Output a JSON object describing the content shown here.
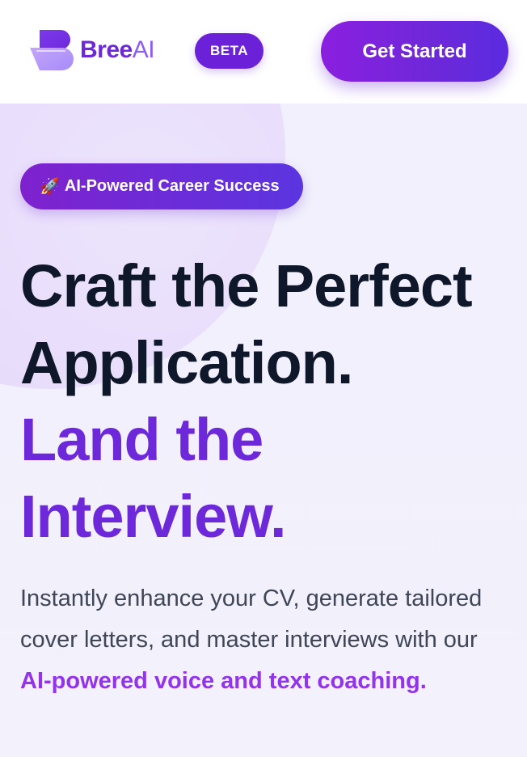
{
  "header": {
    "logo_name": "Bree",
    "logo_suffix": "AI",
    "beta_label": "BETA",
    "cta_label": "Get Started"
  },
  "hero": {
    "tagline_icon": "🚀",
    "tagline": "AI-Powered Career Success",
    "headline_line1": "Craft the Perfect",
    "headline_line2": "Application.",
    "headline_accent_line1": "Land the",
    "headline_accent_line2": "Interview.",
    "description_prefix": "Instantly enhance your CV, generate tailored cover letters, and master interviews with our ",
    "description_highlight": "AI-powered voice and text coaching."
  },
  "colors": {
    "brand": "#6d28d9",
    "accent": "#9333ea",
    "heading": "#0f172a",
    "body_text": "#3f4657",
    "hero_background": "#f1f0fc"
  },
  "icons": {
    "logo": "bree-logo-icon",
    "tagline": "rocket-icon"
  }
}
